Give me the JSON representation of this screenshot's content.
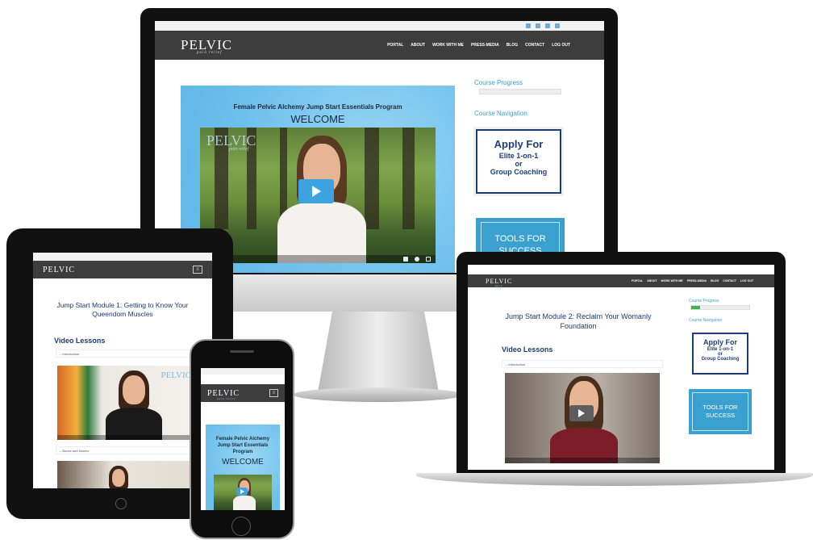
{
  "desktop": {
    "logo": "PELVIC",
    "logo_tag": "pain relief",
    "nav": [
      "PORTAL",
      "ABOUT",
      "WORK WITH ME",
      "PRESS-MEDIA",
      "BLOG",
      "CONTACT",
      "LOG OUT"
    ],
    "banner_title": "Female Pelvic Alchemy Jump Start Essentials Program",
    "banner_welcome": "WELCOME",
    "video_logo": "PELVIC",
    "video_logo_tag": "pain relief",
    "course_progress": "Course Progress",
    "course_navigation": "Course Navigation",
    "apply": {
      "line1": "Apply For",
      "line2": "Elite 1-on-1",
      "line3": "or",
      "line4": "Group Coaching"
    },
    "tools": {
      "line1": "TOOLS FOR",
      "line2": "SUCCESS"
    }
  },
  "tablet": {
    "logo": "PELVIC",
    "menu_icon": "menu-icon",
    "module_title_line1": "Jump Start Module 1: Getting to Know Your",
    "module_title_line2": "Queendom Muscles",
    "video_lessons": "Video Lessons",
    "item1": "Introduction",
    "item2": "Bones and Names",
    "video_logo": "PELVIC"
  },
  "phone": {
    "logo": "PELVIC",
    "logo_tag": "pain relief",
    "banner_line1": "Female Pelvic Alchemy",
    "banner_line2": "Jump Start Essentials",
    "banner_line3": "Program",
    "banner_welcome": "WELCOME"
  },
  "laptop": {
    "logo": "PELVIC",
    "logo_tag": "pain relief",
    "nav": [
      "PORTAL",
      "ABOUT",
      "WORK WITH ME",
      "PRESS-MEDIA",
      "BLOG",
      "CONTACT",
      "LOG OUT"
    ],
    "module_title_line1": "Jump Start Module 2: Reclaim Your Womanly",
    "module_title_line2": "Foundation",
    "video_lessons": "Video Lessons",
    "item1": "Introduction",
    "course_progress": "Course Progress",
    "course_navigation": "Course Navigation",
    "apply": {
      "line1": "Apply For",
      "line2": "Elite 1-on-1",
      "line3": "or",
      "line4": "Group Coaching"
    },
    "tools": {
      "line1": "TOOLS FOR",
      "line2": "SUCCESS"
    },
    "progress_fraction": 0.15
  },
  "colors": {
    "accent": "#3aa0d0",
    "nav": "#3d3d3d",
    "banner": "#7fc9f0",
    "play": "#3aa3e0"
  }
}
